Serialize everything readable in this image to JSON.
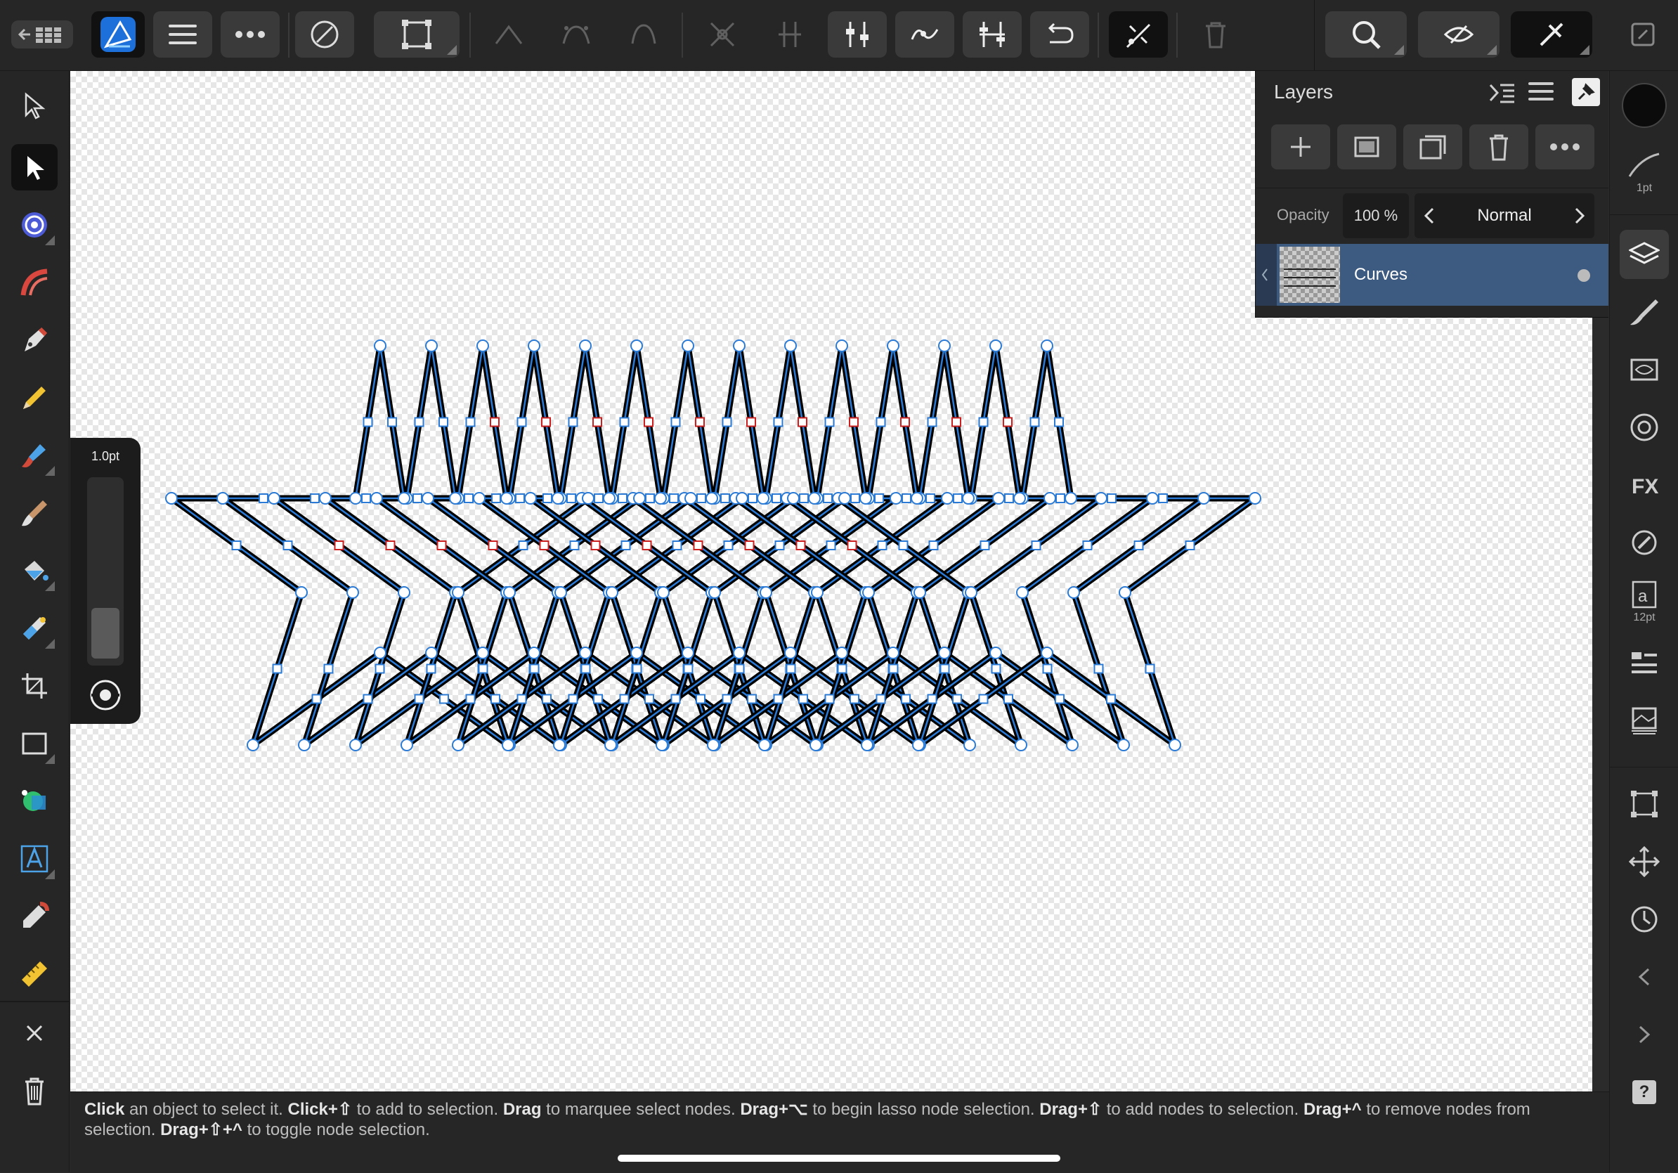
{
  "app": {
    "name": "Affinity Designer"
  },
  "layers_panel": {
    "title": "Layers",
    "opacity_label": "Opacity",
    "opacity_value": "100 %",
    "blend_mode": "Normal",
    "layer_name": "Curves"
  },
  "stroke_popup": {
    "width_label": "1.0pt"
  },
  "right_column": {
    "stroke_width_label": "1pt",
    "text_size_label": "12pt"
  },
  "status": {
    "segments": [
      {
        "t": "Click",
        "b": true
      },
      {
        "t": " an object to select it. ",
        "b": false
      },
      {
        "t": "Click+⇧",
        "b": true
      },
      {
        "t": " to add to selection. ",
        "b": false
      },
      {
        "t": "Drag",
        "b": true
      },
      {
        "t": " to marquee select nodes. ",
        "b": false
      },
      {
        "t": "Drag+⌥",
        "b": true
      },
      {
        "t": " to begin lasso node selection. ",
        "b": false
      },
      {
        "t": "Drag+⇧",
        "b": true
      },
      {
        "t": " to add nodes to selection. ",
        "b": false
      },
      {
        "t": "Drag+^",
        "b": true
      },
      {
        "t": " to remove nodes from selection. ",
        "b": false
      },
      {
        "t": "Drag+⇧+^",
        "b": true
      },
      {
        "t": " to toggle node selection.",
        "b": false
      }
    ]
  },
  "colors": {
    "accent_blue": "#1f6fd1",
    "selection_outline": "#2b7bd6",
    "node_red": "#cc1f1f",
    "layer_row": "#3d5a80"
  }
}
